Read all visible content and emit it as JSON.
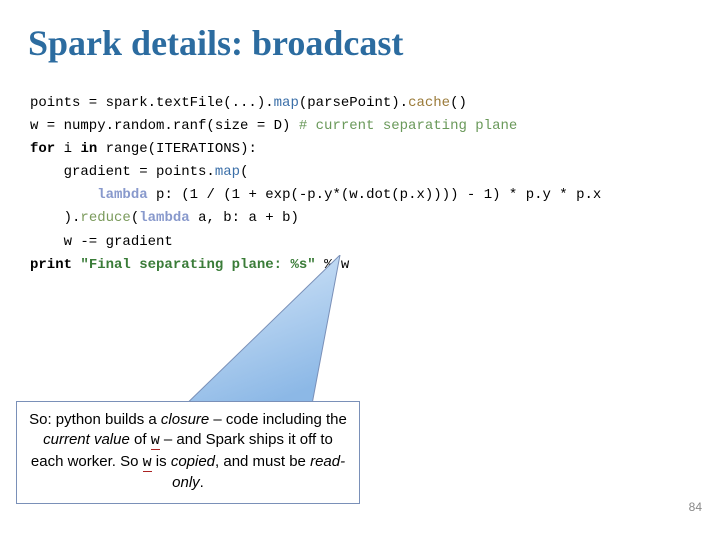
{
  "title": "Spark details: broadcast",
  "code": {
    "l1a": "points = spark.textFile(...).",
    "l1b": "map",
    "l1c": "(parsePoint).",
    "l1d": "cache",
    "l1e": "()",
    "l2a": "w = numpy.random.ranf(size = D) ",
    "l2b": "# current separating plane",
    "l3a": "for",
    "l3b": " i ",
    "l3c": "in",
    "l3d": " range(ITERATIONS):",
    "l4a": "    gradient = points.",
    "l4b": "map",
    "l4c": "(",
    "l5a": "        ",
    "l5b": "lambda",
    "l5c": " p: (1 / (1 + exp(-p.y*(w.dot(p.x)))) - 1) * p.y * p.x",
    "l6a": "    ).",
    "l6b": "reduce",
    "l6c": "(",
    "l6d": "lambda",
    "l6e": " a, b: a + b)",
    "l7": "    w -= gradient",
    "l8a": "print",
    "l8b": " ",
    "l8c": "\"Final separating plane: %s\"",
    "l8d": " % w"
  },
  "callout": {
    "t1": "So: python builds a ",
    "t2": "closure",
    "t3": " – code including the ",
    "t4": "current value",
    "t5": " of ",
    "t6": "w",
    "t7": " – and Spark ships it off to each worker.  So ",
    "t8": "w",
    "t9": " is ",
    "t10": "copied",
    "t11": ", and must be ",
    "t12": "read-only",
    "t13": "."
  },
  "pageNumber": "84",
  "colors": {
    "title": "#2c6ca0",
    "pointerFill": "#a8c8ea",
    "pointerStroke": "#7a90b8"
  }
}
